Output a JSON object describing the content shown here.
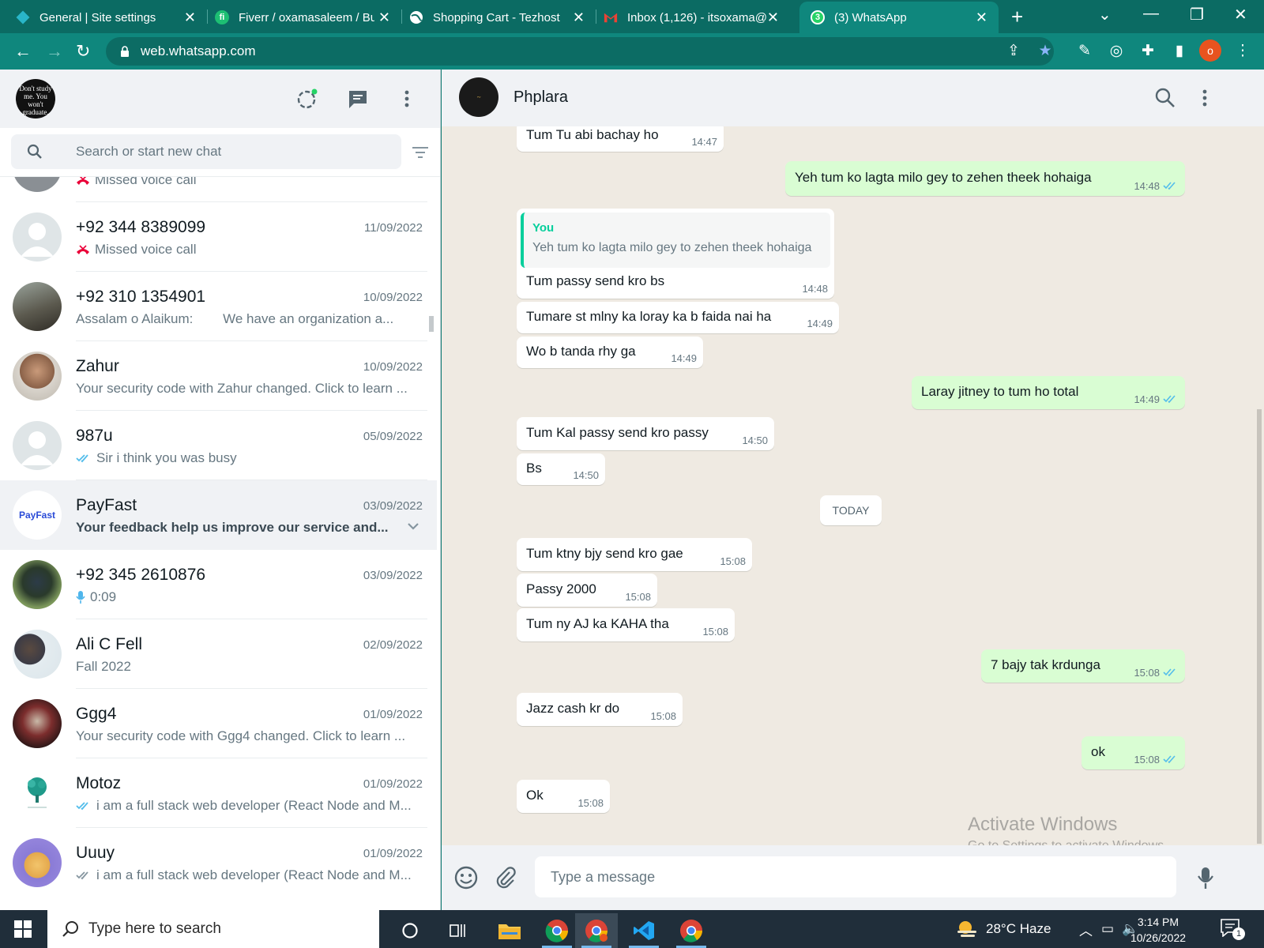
{
  "browser": {
    "tabs": [
      {
        "title": "General | Site settings",
        "icon": "diamond-favicon",
        "active": false
      },
      {
        "title": "Fiverr / oxamasaleem / Bu",
        "icon": "fiverr-favicon",
        "active": false
      },
      {
        "title": "Shopping Cart - Tezhost",
        "icon": "globe-favicon",
        "active": false
      },
      {
        "title": "Inbox (1,126) - itsoxama@",
        "icon": "gmail-favicon",
        "active": false
      },
      {
        "title": "(3) WhatsApp",
        "icon": "whatsapp-favicon",
        "active": true
      }
    ],
    "whatsapp_badge": "3",
    "url": "web.whatsapp.com",
    "profile_initial": "o"
  },
  "left": {
    "my_avatar_text": "Don't study me. You won't graduate.",
    "search_placeholder": "Search or start new chat",
    "chats": [
      {
        "name": "",
        "date": "",
        "preview": "Missed voice call",
        "preview_icon": "missed-call-icon",
        "partial": true
      },
      {
        "name": "+92 344 8389099",
        "date": "11/09/2022",
        "preview": "Missed voice call",
        "preview_icon": "missed-call-icon"
      },
      {
        "name": "+92 310 1354901",
        "date": "10/09/2022",
        "preview": "Assalam o Alaikum:        We have an organization a..."
      },
      {
        "name": "Zahur",
        "date": "10/09/2022",
        "preview": "Your security code with Zahur changed. Click to learn ..."
      },
      {
        "name": "987u",
        "date": "05/09/2022",
        "preview": "Sir i think you was busy",
        "preview_icon": "double-tick-icon"
      },
      {
        "name": "PayFast",
        "date": "03/09/2022",
        "preview": "Your feedback help us improve our service and...",
        "bold": true,
        "selected": true,
        "avatar_text": "PayFast"
      },
      {
        "name": "+92 345 2610876",
        "date": "03/09/2022",
        "preview": "0:09",
        "preview_icon": "mic-icon"
      },
      {
        "name": "Ali C Fell",
        "date": "02/09/2022",
        "preview": "Fall 2022"
      },
      {
        "name": "Ggg4",
        "date": "01/09/2022",
        "preview": "Your security code with Ggg4 changed. Click to learn ..."
      },
      {
        "name": "Motoz",
        "date": "01/09/2022",
        "preview": "i am a full stack web developer (React Node and M...",
        "preview_icon": "double-tick-icon"
      },
      {
        "name": "Uuuy",
        "date": "01/09/2022",
        "preview": "i am a full stack web developer (React Node and M...",
        "preview_icon": "double-tick-icon"
      }
    ]
  },
  "conversation": {
    "contact_name": "Phplara",
    "messages": [
      {
        "dir": "in",
        "text": "Tum Tu abi bachay ho",
        "time": "14:47"
      },
      {
        "dir": "out",
        "text": "Yeh tum ko lagta milo gey to zehen theek hohaiga",
        "time": "14:48"
      },
      {
        "dir": "in",
        "text": "Tum passy send kro bs",
        "time": "14:48",
        "quote_author": "You",
        "quote_text": "Yeh tum ko lagta milo gey to zehen theek hohaiga"
      },
      {
        "dir": "in",
        "text": "Tumare st mlny ka loray ka b faida nai ha",
        "time": "14:49"
      },
      {
        "dir": "in",
        "text": "Wo b tanda rhy ga",
        "time": "14:49"
      },
      {
        "dir": "out",
        "text": "Laray jitney to tum ho total",
        "time": "14:49"
      },
      {
        "dir": "in",
        "text": "Tum Kal passy send kro passy",
        "time": "14:50"
      },
      {
        "dir": "in",
        "text": "Bs",
        "time": "14:50"
      },
      {
        "dir": "in",
        "text": "Tum ktny bjy send kro gae",
        "time": "15:08"
      },
      {
        "dir": "in",
        "text": "Passy 2000",
        "time": "15:08"
      },
      {
        "dir": "in",
        "text": "Tum ny AJ ka KAHA tha",
        "time": "15:08"
      },
      {
        "dir": "out",
        "text": "7 bajy tak krdunga",
        "time": "15:08"
      },
      {
        "dir": "in",
        "text": "Jazz cash kr do",
        "time": "15:08"
      },
      {
        "dir": "out",
        "text": "ok",
        "time": "15:08"
      },
      {
        "dir": "in",
        "text": "Ok",
        "time": "15:08"
      }
    ],
    "day_label": "TODAY",
    "composer_placeholder": "Type a message",
    "watermark_title": "Activate Windows",
    "watermark_sub": "Go to Settings to activate Windows."
  },
  "taskbar": {
    "search_text": "Type here to search",
    "weather": "28°C  Haze",
    "time": "3:14 PM",
    "date": "10/26/2022",
    "notification_count": "1"
  },
  "colors": {
    "chrome_tab_bg": "#0b6b63",
    "chrome_toolbar": "#0f877d",
    "outgoing_bubble": "#d9fdd3",
    "incoming_bubble": "#ffffff",
    "chat_bg": "#efeae2",
    "accent_green": "#06cf9c",
    "tick_blue": "#53bdeb",
    "missed_call_red": "#ea0038"
  }
}
